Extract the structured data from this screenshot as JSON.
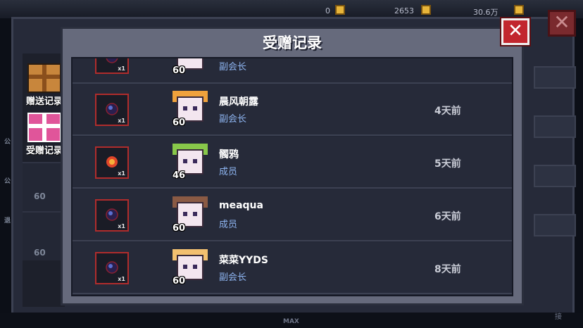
{
  "hud": {
    "values": [
      "0",
      "2653",
      "30.6万"
    ]
  },
  "background": {
    "side_levels": [
      "60",
      "60"
    ],
    "side_chars": [
      "公",
      "公",
      "退"
    ],
    "bottom_max": "MAX",
    "bottom_right": "接"
  },
  "sidebar": {
    "tabs": [
      {
        "label": "赠送记录",
        "color": "#c8863c"
      },
      {
        "label": "受赠记录",
        "color": "#e0559a"
      }
    ]
  },
  "dialog": {
    "title": "受赠记录",
    "close_label": "✕"
  },
  "records": [
    {
      "gift": "dark-orb",
      "qty": "x1",
      "level": "60",
      "name": "",
      "role": "副会长",
      "time": "",
      "avatar_color": "#e79ad2"
    },
    {
      "gift": "dark-orb",
      "qty": "x1",
      "level": "60",
      "name": "晨风朝露",
      "role": "副会长",
      "time": "4天前",
      "avatar_color": "#f0a23c"
    },
    {
      "gift": "fire-orb",
      "qty": "x1",
      "level": "46",
      "name": "髑鸦",
      "role": "成员",
      "time": "5天前",
      "avatar_color": "#88c84a"
    },
    {
      "gift": "dark-orb",
      "qty": "x1",
      "level": "60",
      "name": "meaqua",
      "role": "成员",
      "time": "6天前",
      "avatar_color": "#8a5a44"
    },
    {
      "gift": "dark-orb",
      "qty": "x1",
      "level": "60",
      "name": "菜菜YYDS",
      "role": "副会长",
      "time": "8天前",
      "avatar_color": "#f2c070"
    }
  ],
  "colors": {
    "accent_red": "#c2262e",
    "role_blue": "#8db4f0"
  }
}
